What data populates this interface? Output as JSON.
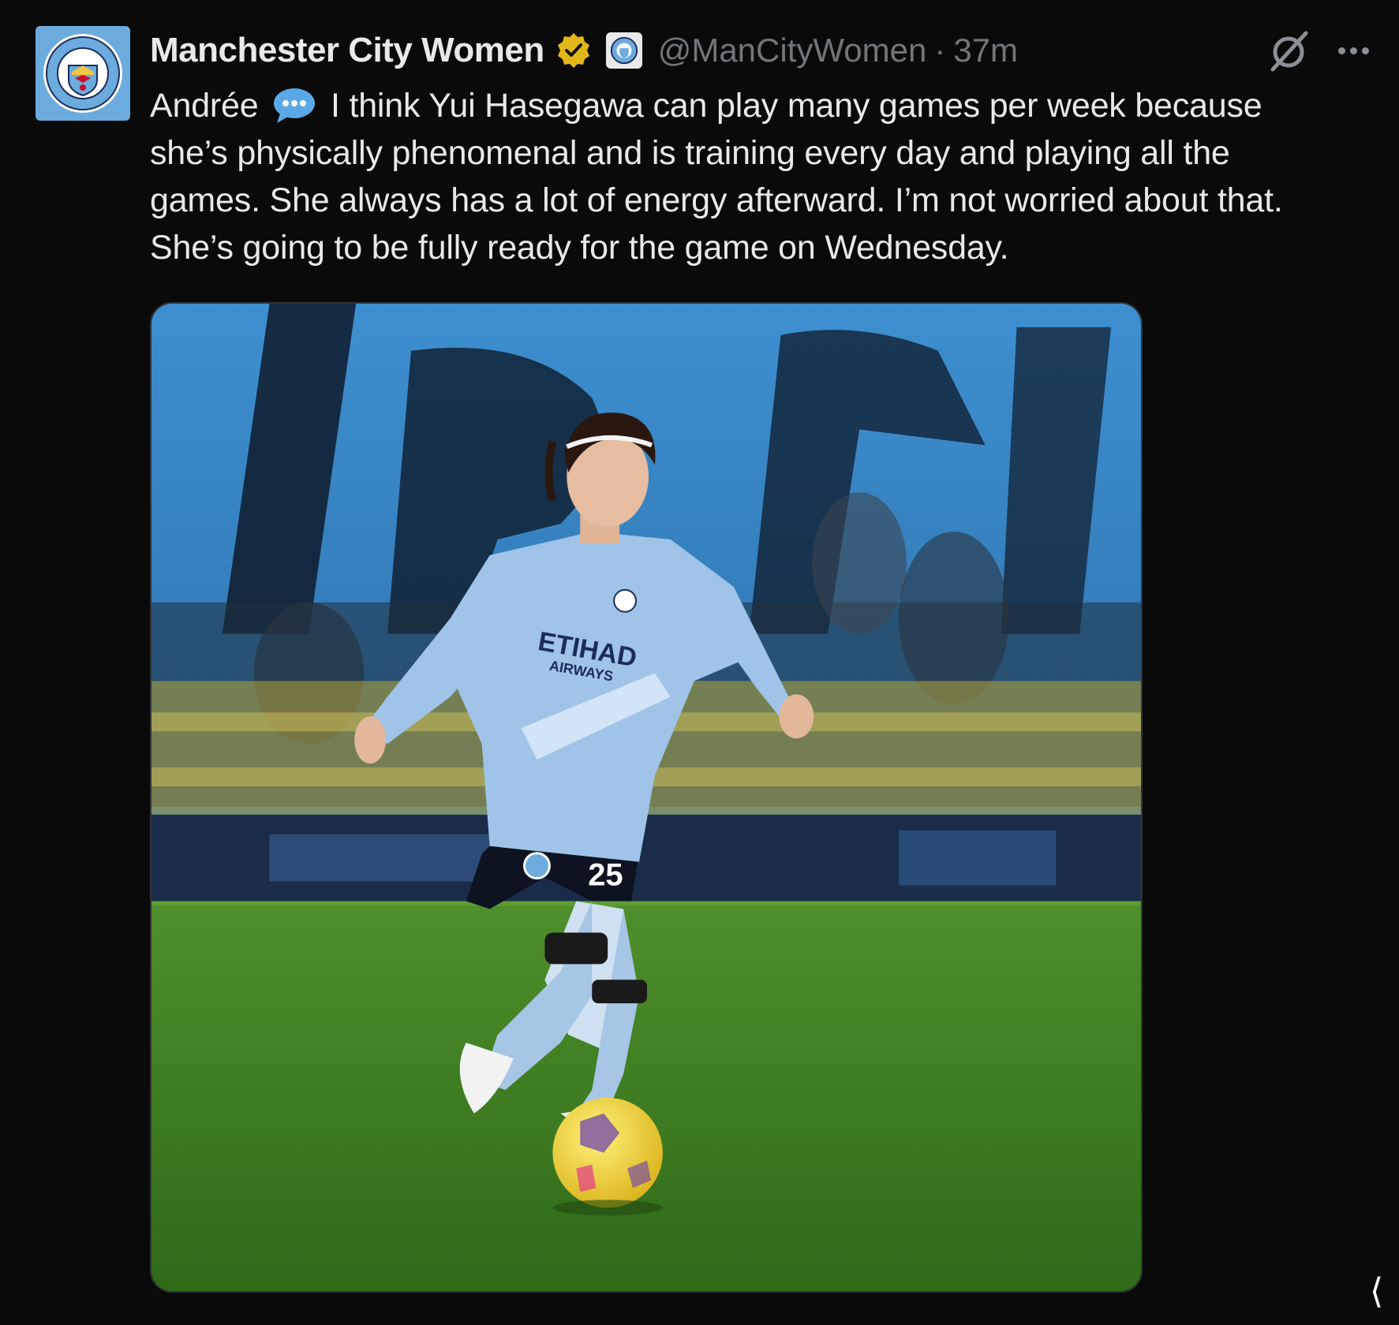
{
  "post": {
    "display_name": "Manchester City Women",
    "handle": "@ManCityWomen",
    "separator": "·",
    "time": "37m",
    "text_prefix": "Andrée",
    "text_body": "I think Yui Hasegawa can play many games per week because she’s physically phenomenal and is training every day and playing all the games. She always has a lot of energy afterward. I’m not worried about that. She’s going to be fully ready for the game on Wednesday.",
    "verified": true,
    "verified_badge_color": "#e2b719"
  },
  "icons": {
    "avatar": "club-crest-avatar",
    "verified": "verified-badge-icon",
    "affiliate": "affiliate-badge-icon",
    "speech": "speech-bubble-icon",
    "grok": "grok-icon",
    "more": "more-icon"
  },
  "media": {
    "type": "photo",
    "shirt_number": "25",
    "sponsor_line1": "ETIHAD",
    "sponsor_line2": "AIRWAYS"
  },
  "theme": {
    "background": "#0a0a0a",
    "text": "#e7e9ea",
    "muted": "#71767b",
    "club_blue": "#6cabdd"
  }
}
